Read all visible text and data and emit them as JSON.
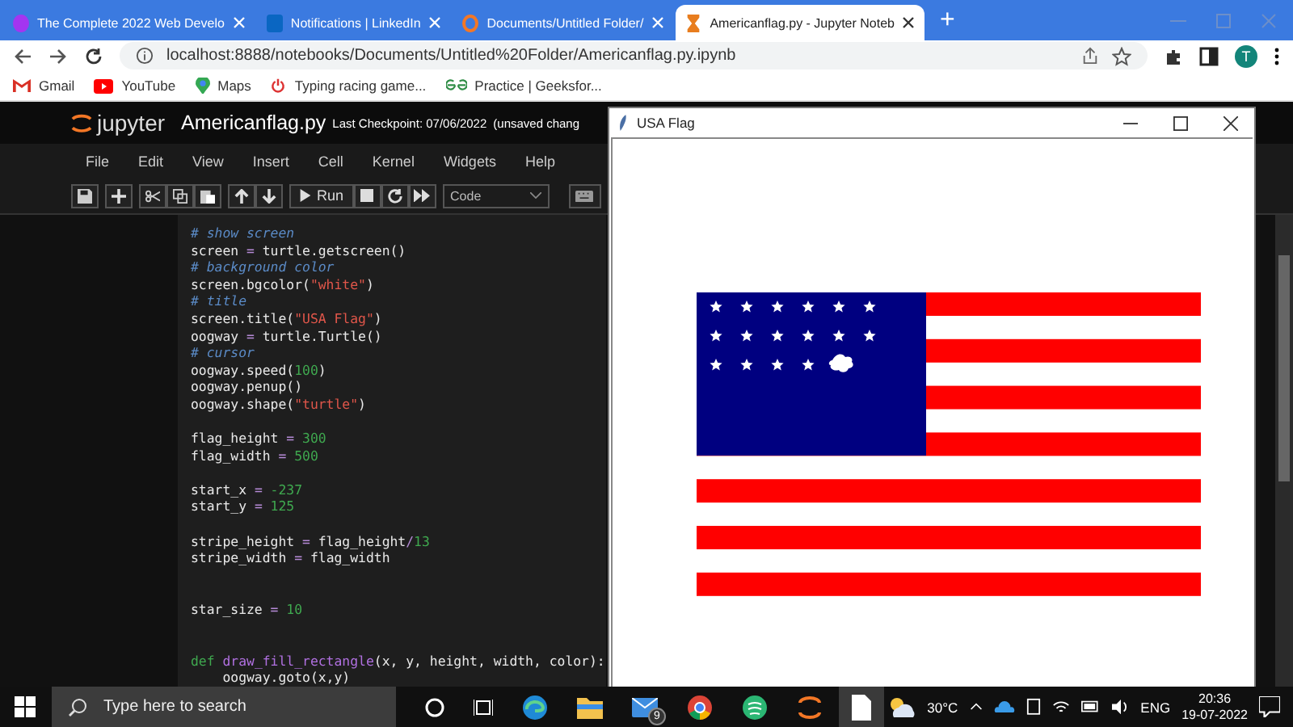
{
  "browser": {
    "tabs": [
      {
        "title": "The Complete 2022 Web Develo",
        "kind": "course",
        "selected": false
      },
      {
        "title": "Notifications | LinkedIn",
        "kind": "network",
        "selected": false
      },
      {
        "title": "Documents/Untitled Folder/",
        "kind": "jupyter",
        "selected": false
      },
      {
        "title": "Americanflag.py - Jupyter Noteb",
        "kind": "hourglass",
        "selected": true
      }
    ],
    "new_tab": "+",
    "address": "localhost:8888/notebooks/Documents/Untitled%20Folder/Americanflag.py.ipynb",
    "avatar": "T",
    "bookmarks": [
      {
        "label": "Gmail",
        "kind": "mail"
      },
      {
        "label": "YouTube",
        "kind": "video"
      },
      {
        "label": "Maps",
        "kind": "pin"
      },
      {
        "label": "Typing racing game...",
        "kind": "power"
      },
      {
        "label": "Practice | Geeksfor...",
        "kind": "gg"
      }
    ]
  },
  "notebook": {
    "logo": "jupyter",
    "title": "Americanflag.py",
    "checkpoint": "Last Checkpoint: 07/06/2022",
    "unsaved": "(unsaved chang",
    "menu": [
      "File",
      "Edit",
      "View",
      "Insert",
      "Cell",
      "Kernel",
      "Widgets",
      "Help"
    ],
    "run_label": "Run",
    "cell_type": "Code",
    "lines": [
      {
        "blank_before": false,
        "tokens": [
          {
            "kind": "comment",
            "t": "# show screen"
          }
        ]
      },
      {
        "blank_before": false,
        "tokens": [
          {
            "kind": "plain",
            "t": "screen "
          },
          {
            "kind": "op",
            "t": "="
          },
          {
            "kind": "plain",
            "t": " turtle.getscreen()"
          }
        ]
      },
      {
        "blank_before": false,
        "tokens": [
          {
            "kind": "comment",
            "t": "# background color"
          }
        ]
      },
      {
        "blank_before": false,
        "tokens": [
          {
            "kind": "plain",
            "t": "screen.bgcolor("
          },
          {
            "kind": "string",
            "t": "\"white\""
          },
          {
            "kind": "plain",
            "t": ")"
          }
        ]
      },
      {
        "blank_before": false,
        "tokens": [
          {
            "kind": "comment",
            "t": "# title"
          }
        ]
      },
      {
        "blank_before": false,
        "tokens": [
          {
            "kind": "plain",
            "t": "screen.title("
          },
          {
            "kind": "string",
            "t": "\"USA Flag\""
          },
          {
            "kind": "plain",
            "t": ")"
          }
        ]
      },
      {
        "blank_before": false,
        "tokens": [
          {
            "kind": "plain",
            "t": "oogway "
          },
          {
            "kind": "op",
            "t": "="
          },
          {
            "kind": "plain",
            "t": " turtle.Turtle()"
          }
        ]
      },
      {
        "blank_before": false,
        "tokens": [
          {
            "kind": "comment",
            "t": "# cursor"
          }
        ]
      },
      {
        "blank_before": false,
        "tokens": [
          {
            "kind": "plain",
            "t": "oogway.speed("
          },
          {
            "kind": "number",
            "t": "100"
          },
          {
            "kind": "plain",
            "t": ")"
          }
        ]
      },
      {
        "blank_before": false,
        "tokens": [
          {
            "kind": "plain",
            "t": "oogway.penup()"
          }
        ]
      },
      {
        "blank_before": false,
        "tokens": [
          {
            "kind": "plain",
            "t": "oogway.shape("
          },
          {
            "kind": "string",
            "t": "\"turtle\""
          },
          {
            "kind": "plain",
            "t": ")"
          }
        ]
      },
      {
        "blank_before": true,
        "tokens": [
          {
            "kind": "plain",
            "t": "flag_height "
          },
          {
            "kind": "op",
            "t": "="
          },
          {
            "kind": "number",
            "t": " 300"
          }
        ]
      },
      {
        "blank_before": false,
        "tokens": [
          {
            "kind": "plain",
            "t": "flag_width "
          },
          {
            "kind": "op",
            "t": "="
          },
          {
            "kind": "number",
            "t": " 500"
          }
        ]
      },
      {
        "blank_before": true,
        "tokens": [
          {
            "kind": "plain",
            "t": "start_x "
          },
          {
            "kind": "op",
            "t": "="
          },
          {
            "kind": "number",
            "t": " -237"
          }
        ]
      },
      {
        "blank_before": false,
        "tokens": [
          {
            "kind": "plain",
            "t": "start_y "
          },
          {
            "kind": "op",
            "t": "="
          },
          {
            "kind": "number",
            "t": " 125"
          }
        ]
      },
      {
        "blank_before": true,
        "tokens": [
          {
            "kind": "plain",
            "t": "stripe_height "
          },
          {
            "kind": "op",
            "t": "="
          },
          {
            "kind": "plain",
            "t": " flag_height"
          },
          {
            "kind": "op",
            "t": "/"
          },
          {
            "kind": "number",
            "t": "13"
          }
        ]
      },
      {
        "blank_before": false,
        "tokens": [
          {
            "kind": "plain",
            "t": "stripe_width "
          },
          {
            "kind": "op",
            "t": "="
          },
          {
            "kind": "plain",
            "t": " flag_width"
          }
        ]
      },
      {
        "blank_before": true,
        "double_gap": true,
        "tokens": [
          {
            "kind": "plain",
            "t": "star_size "
          },
          {
            "kind": "op",
            "t": "="
          },
          {
            "kind": "number",
            "t": " 10"
          }
        ]
      },
      {
        "blank_before": true,
        "double_gap": true,
        "tokens": [
          {
            "kind": "keyword",
            "t": "def"
          },
          {
            "kind": "defname",
            "t": " draw_fill_rectangle"
          },
          {
            "kind": "plain",
            "t": "(x, y, height, width, color):"
          }
        ]
      },
      {
        "blank_before": false,
        "tokens": [
          {
            "kind": "plain",
            "t": "    oogway.goto(x,y)"
          }
        ]
      }
    ]
  },
  "flag_window": {
    "title": "USA Flag"
  },
  "taskbar": {
    "search_placeholder": "Type here to search",
    "mail_badge": "9",
    "weather": "30°C",
    "language": "ENG",
    "time": "20:36",
    "date": "19-07-2022"
  }
}
